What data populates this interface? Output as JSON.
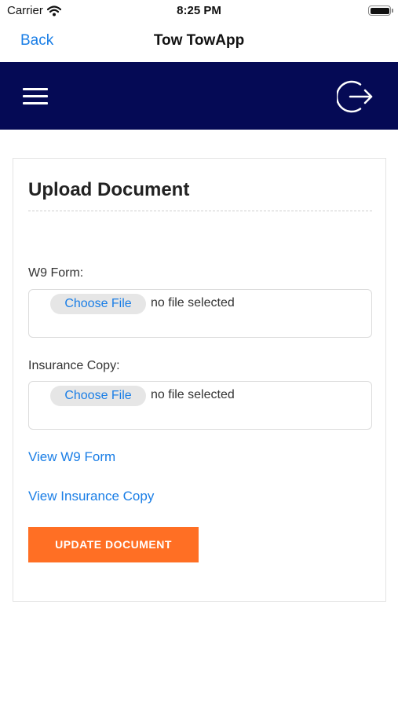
{
  "status_bar": {
    "carrier": "Carrier",
    "time": "8:25 PM",
    "icons": [
      "wifi-icon",
      "battery-icon"
    ]
  },
  "nav_bar": {
    "back_label": "Back",
    "title": "Tow TowApp"
  },
  "header": {
    "background_color": "#050a55",
    "menu_icon": "hamburger-menu-icon",
    "logout_icon": "logout-icon"
  },
  "card": {
    "title": "Upload Document",
    "fields": [
      {
        "label": "W9 Form:",
        "button_label": "Choose File",
        "value_text": "no file selected"
      },
      {
        "label": "Insurance Copy:",
        "button_label": "Choose File",
        "value_text": "no file selected"
      }
    ],
    "links": [
      {
        "label": "View W9 Form"
      },
      {
        "label": "View Insurance Copy"
      }
    ],
    "submit_label": "UPDATE DOCUMENT"
  },
  "colors": {
    "link": "#1a7ee6",
    "accent": "#ff6f24",
    "header": "#050a55"
  }
}
